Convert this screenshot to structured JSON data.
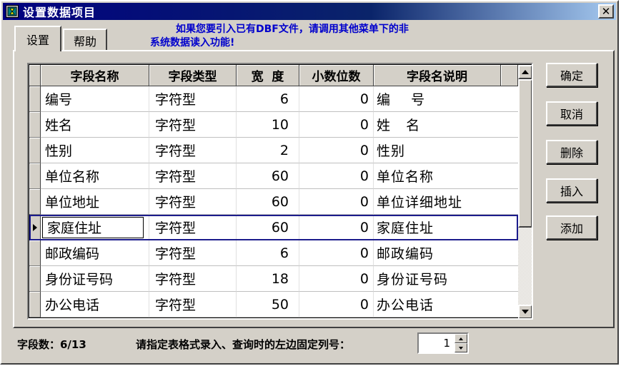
{
  "window": {
    "title": "设置数据项目",
    "icon": "hourglass-app-icon",
    "close_label": "✕"
  },
  "tabs": [
    {
      "label": "设置",
      "active": true
    },
    {
      "label": "帮助",
      "active": false
    }
  ],
  "hint": {
    "line1": "如果您要引入已有DBF文件，请调用其他菜单下的非",
    "line2": "系统数据读入功能!"
  },
  "grid": {
    "columns": [
      "字段名称",
      "字段类型",
      "宽  度",
      "小数位数",
      "字段名说明"
    ],
    "rows": [
      {
        "name": "编号",
        "type": "字符型",
        "width": "6",
        "decimals": "0",
        "desc": "编    号"
      },
      {
        "name": "姓名",
        "type": "字符型",
        "width": "10",
        "decimals": "0",
        "desc": "姓   名"
      },
      {
        "name": "性别",
        "type": "字符型",
        "width": "2",
        "decimals": "0",
        "desc": "性别"
      },
      {
        "name": "单位名称",
        "type": "字符型",
        "width": "60",
        "decimals": "0",
        "desc": "单位名称"
      },
      {
        "name": "单位地址",
        "type": "字符型",
        "width": "60",
        "decimals": "0",
        "desc": "单位详细地址"
      },
      {
        "name": "家庭住址",
        "type": "字符型",
        "width": "60",
        "decimals": "0",
        "desc": "家庭住址"
      },
      {
        "name": "邮政编码",
        "type": "字符型",
        "width": "6",
        "decimals": "0",
        "desc": "邮政编码"
      },
      {
        "name": "身份证号码",
        "type": "字符型",
        "width": "18",
        "decimals": "0",
        "desc": "身份证号码"
      },
      {
        "name": "办公电话",
        "type": "字符型",
        "width": "50",
        "decimals": "0",
        "desc": "办公电话"
      }
    ],
    "current_row_index": 5
  },
  "buttons": {
    "ok": "确定",
    "cancel": "取消",
    "delete": "删除",
    "insert": "插入",
    "add": "添加"
  },
  "status": {
    "field_count": "字段数：6/13",
    "freeze_label": "请指定表格式录入、查询时的左边固定列号：",
    "freeze_value": "1"
  },
  "colors": {
    "titlebar": "#000080",
    "hint_text": "#0000cc",
    "face": "#d4d0c8",
    "current_row_outline": "#1c1c8c"
  }
}
